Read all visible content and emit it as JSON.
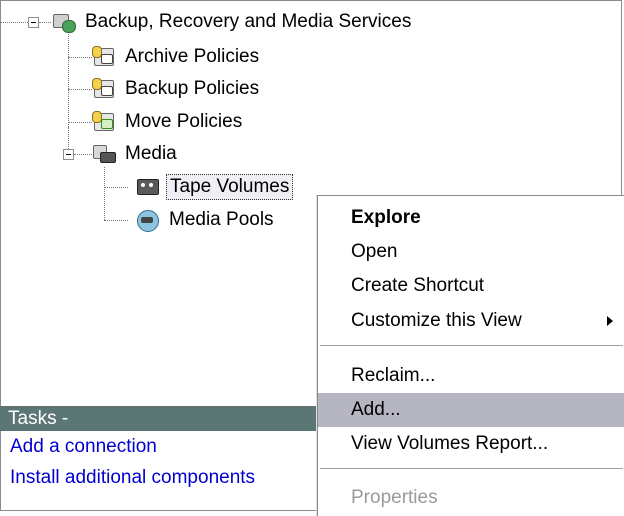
{
  "tree": {
    "root": "Backup, Recovery and Media Services",
    "archive_policies": "Archive Policies",
    "backup_policies": "Backup Policies",
    "move_policies": "Move Policies",
    "media": "Media",
    "tape_volumes": "Tape Volumes",
    "media_pools": "Media Pools"
  },
  "tasks": {
    "header": "Tasks -",
    "links": [
      "Add a connection",
      "Install additional components"
    ]
  },
  "context_menu": {
    "explore": "Explore",
    "open": "Open",
    "create_shortcut": "Create Shortcut",
    "customize": "Customize this View",
    "reclaim": "Reclaim...",
    "add": "Add...",
    "view_report": "View Volumes Report...",
    "properties": "Properties"
  },
  "colors": {
    "tasks_header_bg": "#5a7675",
    "link": "#0000d0",
    "menu_hover": "#b6b6c3"
  }
}
